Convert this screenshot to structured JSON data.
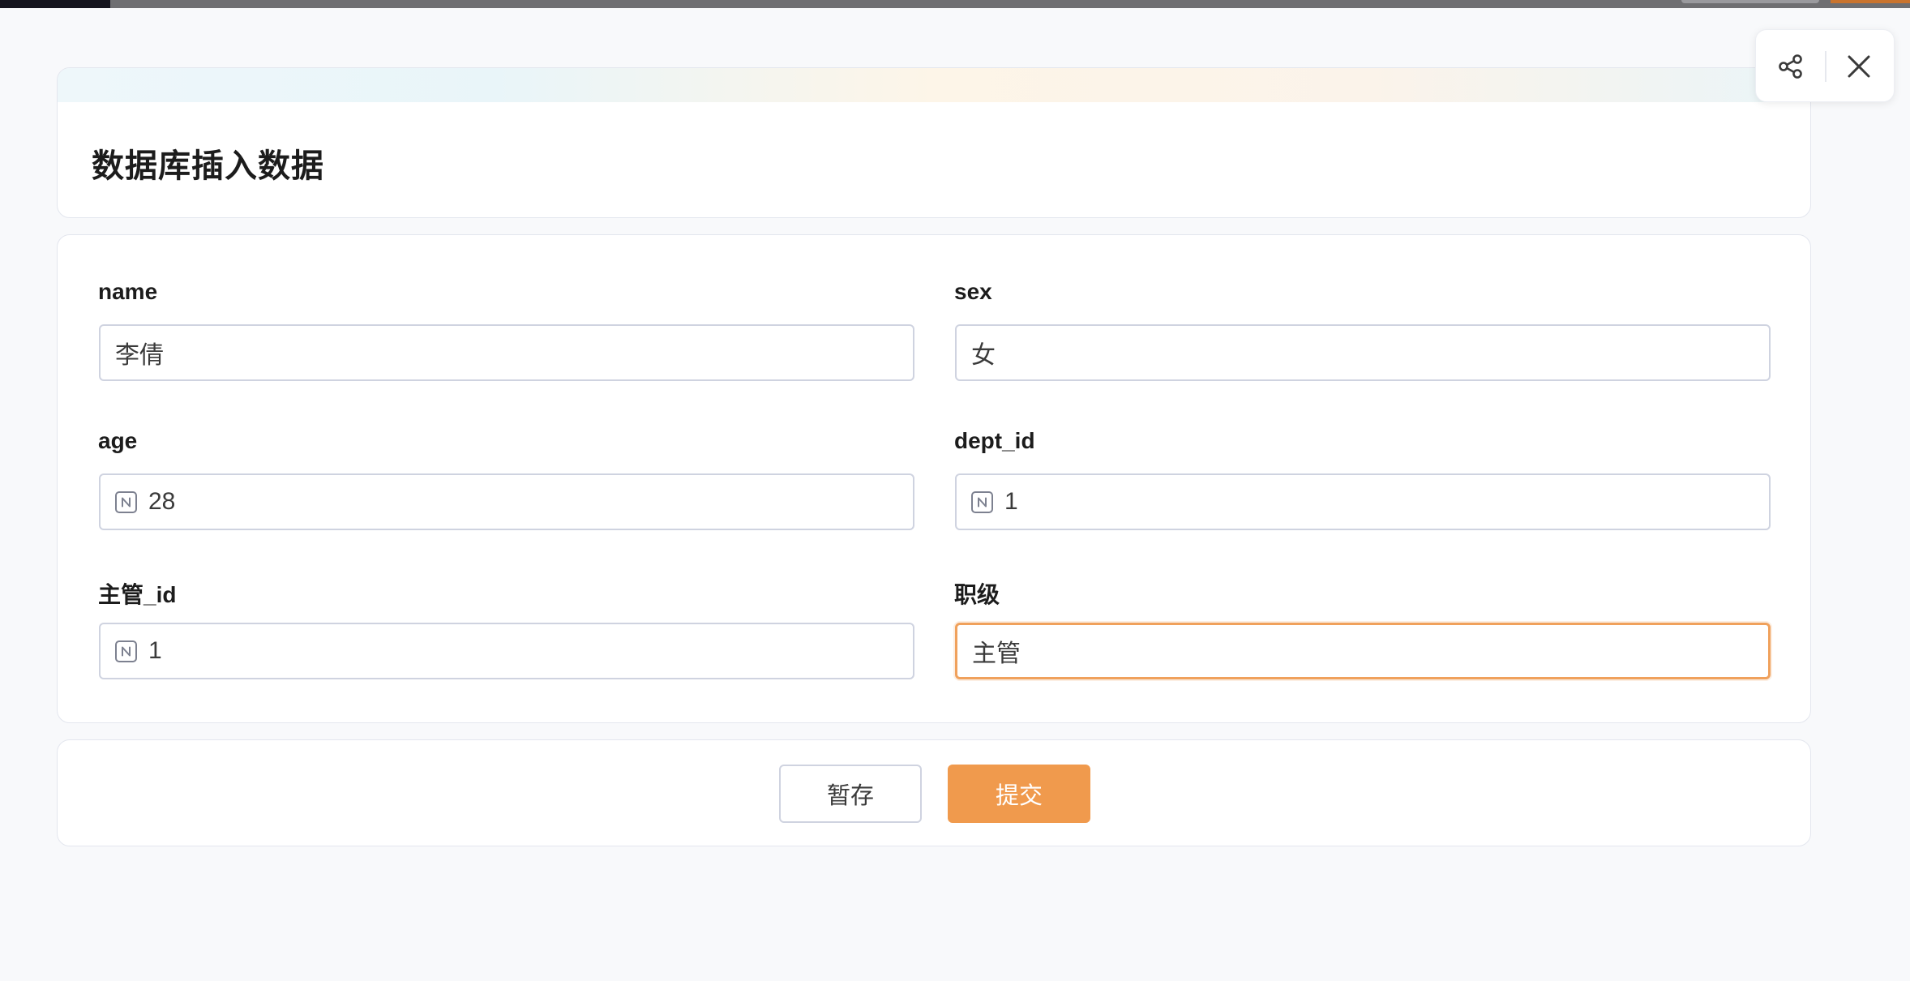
{
  "page": {
    "title": "数据库插入数据"
  },
  "form": {
    "fields": [
      {
        "label": "name",
        "value": "李倩",
        "numeric": false
      },
      {
        "label": "sex",
        "value": "女",
        "numeric": false
      },
      {
        "label": "age",
        "value": "28",
        "numeric": true
      },
      {
        "label": "dept_id",
        "value": "1",
        "numeric": true
      },
      {
        "label": "主管_id",
        "value": "1",
        "numeric": true
      },
      {
        "label": "职级",
        "value": "主管",
        "numeric": false
      }
    ]
  },
  "actions": {
    "save_draft_label": "暂存",
    "submit_label": "提交"
  },
  "toolbar": {
    "share_icon": "share-icon",
    "close_icon": "close-icon"
  },
  "colors": {
    "accent": "#f09a4d",
    "focus_border": "#f0a15c",
    "input_border": "#cfd3e0"
  }
}
